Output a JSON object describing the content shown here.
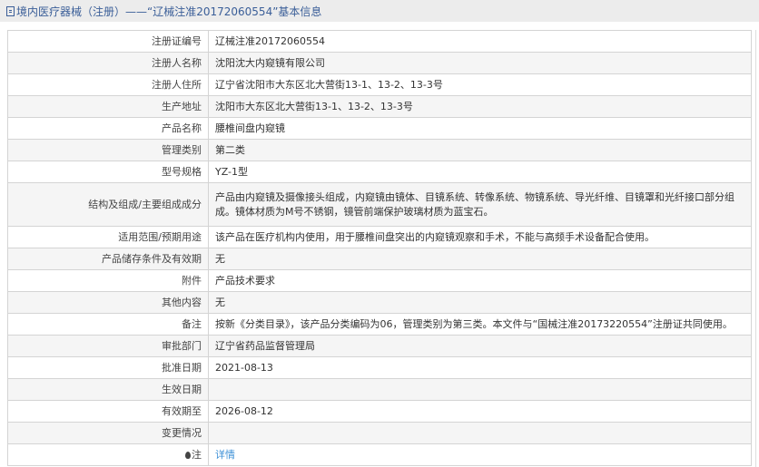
{
  "header": {
    "title": "境内医疗器械（注册）——“辽械注准20172060554”基本信息"
  },
  "rows": [
    {
      "label": "注册证编号",
      "value": "辽械注准20172060554"
    },
    {
      "label": "注册人名称",
      "value": "沈阳沈大内窥镜有限公司"
    },
    {
      "label": "注册人住所",
      "value": "辽宁省沈阳市大东区北大营街13-1、13-2、13-3号"
    },
    {
      "label": "生产地址",
      "value": "沈阳市大东区北大营街13-1、13-2、13-3号"
    },
    {
      "label": "产品名称",
      "value": "腰椎间盘内窥镜"
    },
    {
      "label": "管理类别",
      "value": "第二类"
    },
    {
      "label": "型号规格",
      "value": "YZ-1型"
    },
    {
      "label": "结构及组成/主要组成成分",
      "value": "产品由内窥镜及摄像接头组成，内窥镜由镜体、目镜系统、转像系统、物镜系统、导光纤维、目镜罩和光纤接口部分组成。镜体材质为M号不锈钢，镜管前端保护玻璃材质为蓝宝石。"
    },
    {
      "label": "适用范围/预期用途",
      "value": "该产品在医疗机构内使用，用于腰椎间盘突出的内窥镜观察和手术，不能与高频手术设备配合使用。"
    },
    {
      "label": "产品储存条件及有效期",
      "value": "无"
    },
    {
      "label": "附件",
      "value": "产品技术要求"
    },
    {
      "label": "其他内容",
      "value": "无"
    },
    {
      "label": "备注",
      "value": "按新《分类目录》，该产品分类编码为06，管理类别为第三类。本文件与“国械注准20173220554”注册证共同使用。"
    },
    {
      "label": "审批部门",
      "value": "辽宁省药品监督管理局"
    },
    {
      "label": "批准日期",
      "value": "2021-08-13"
    },
    {
      "label": "生效日期",
      "value": ""
    },
    {
      "label": "有效期至",
      "value": "2026-08-12"
    },
    {
      "label": "变更情况",
      "value": ""
    }
  ],
  "note": {
    "label": "注",
    "link": "详情"
  }
}
